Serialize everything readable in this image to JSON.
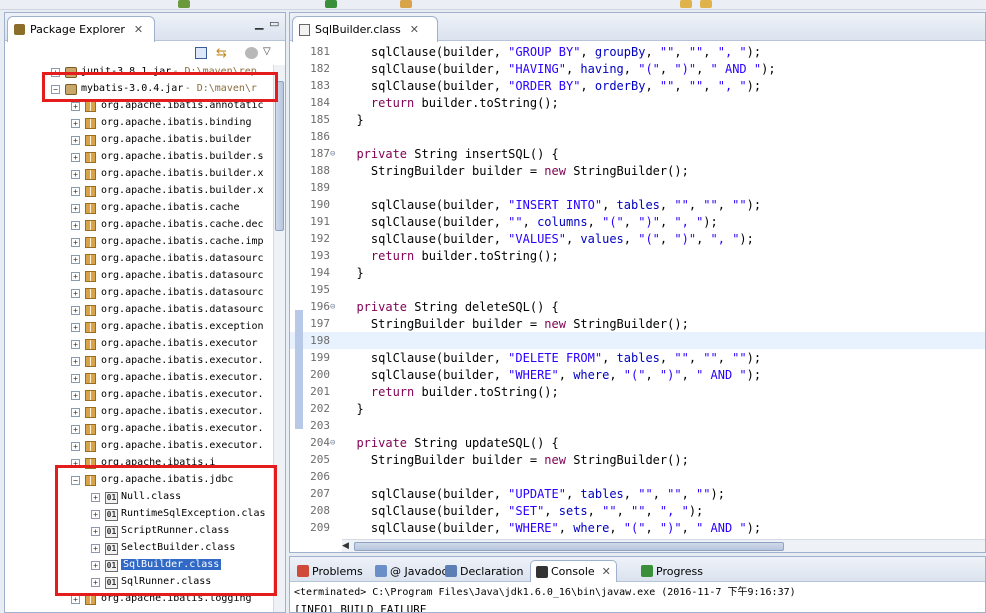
{
  "left_panel": {
    "tab_title": "Package Explorer",
    "tree": [
      {
        "indent": 1,
        "type": "jar",
        "label": "junit-3.8.1.jar",
        "path": " - D:\\maven\\rep"
      },
      {
        "indent": 1,
        "type": "jar",
        "label": "mybatis-3.0.4.jar",
        "path": " - D:\\maven\\r",
        "expanded": true
      },
      {
        "indent": 2,
        "type": "pkg",
        "label": "org.apache.ibatis.annotatic"
      },
      {
        "indent": 2,
        "type": "pkg",
        "label": "org.apache.ibatis.binding"
      },
      {
        "indent": 2,
        "type": "pkg",
        "label": "org.apache.ibatis.builder"
      },
      {
        "indent": 2,
        "type": "pkg",
        "label": "org.apache.ibatis.builder.s"
      },
      {
        "indent": 2,
        "type": "pkg",
        "label": "org.apache.ibatis.builder.x"
      },
      {
        "indent": 2,
        "type": "pkg",
        "label": "org.apache.ibatis.builder.x"
      },
      {
        "indent": 2,
        "type": "pkg",
        "label": "org.apache.ibatis.cache"
      },
      {
        "indent": 2,
        "type": "pkg",
        "label": "org.apache.ibatis.cache.dec"
      },
      {
        "indent": 2,
        "type": "pkg",
        "label": "org.apache.ibatis.cache.imp"
      },
      {
        "indent": 2,
        "type": "pkg",
        "label": "org.apache.ibatis.datasourc"
      },
      {
        "indent": 2,
        "type": "pkg",
        "label": "org.apache.ibatis.datasourc"
      },
      {
        "indent": 2,
        "type": "pkg",
        "label": "org.apache.ibatis.datasourc"
      },
      {
        "indent": 2,
        "type": "pkg",
        "label": "org.apache.ibatis.datasourc"
      },
      {
        "indent": 2,
        "type": "pkg",
        "label": "org.apache.ibatis.exception"
      },
      {
        "indent": 2,
        "type": "pkg",
        "label": "org.apache.ibatis.executor"
      },
      {
        "indent": 2,
        "type": "pkg",
        "label": "org.apache.ibatis.executor."
      },
      {
        "indent": 2,
        "type": "pkg",
        "label": "org.apache.ibatis.executor."
      },
      {
        "indent": 2,
        "type": "pkg",
        "label": "org.apache.ibatis.executor."
      },
      {
        "indent": 2,
        "type": "pkg",
        "label": "org.apache.ibatis.executor."
      },
      {
        "indent": 2,
        "type": "pkg",
        "label": "org.apache.ibatis.executor."
      },
      {
        "indent": 2,
        "type": "pkg",
        "label": "org.apache.ibatis.executor."
      },
      {
        "indent": 2,
        "type": "pkg",
        "label": "org.apache.ibatis.i"
      },
      {
        "indent": 2,
        "type": "pkg",
        "label": "org.apache.ibatis.jdbc",
        "expanded": true
      },
      {
        "indent": 3,
        "type": "cls",
        "label": "Null.class"
      },
      {
        "indent": 3,
        "type": "cls",
        "label": "RuntimeSqlException.clas"
      },
      {
        "indent": 3,
        "type": "cls",
        "label": "ScriptRunner.class"
      },
      {
        "indent": 3,
        "type": "cls",
        "label": "SelectBuilder.class"
      },
      {
        "indent": 3,
        "type": "cls",
        "label": "SqlBuilder.class",
        "selected": true
      },
      {
        "indent": 3,
        "type": "cls",
        "label": "SqlRunner.class"
      },
      {
        "indent": 2,
        "type": "pkg",
        "label": "org.apache.ibatis.logging"
      }
    ]
  },
  "editor": {
    "tab_title": "SqlBuilder.class",
    "lines": [
      {
        "n": "181",
        "tokens": [
          [
            "",
            "    sqlClause(builder, "
          ],
          [
            "str",
            "\"GROUP BY\""
          ],
          [
            "",
            ", "
          ],
          [
            "fld",
            "groupBy"
          ],
          [
            "",
            ", "
          ],
          [
            "str",
            "\"\""
          ],
          [
            "",
            ", "
          ],
          [
            "str",
            "\"\""
          ],
          [
            "",
            ", "
          ],
          [
            "str",
            "\", \""
          ],
          [
            "",
            ");"
          ]
        ]
      },
      {
        "n": "182",
        "tokens": [
          [
            "",
            "    sqlClause(builder, "
          ],
          [
            "str",
            "\"HAVING\""
          ],
          [
            "",
            ", "
          ],
          [
            "fld",
            "having"
          ],
          [
            "",
            ", "
          ],
          [
            "str",
            "\"(\""
          ],
          [
            "",
            ", "
          ],
          [
            "str",
            "\")\""
          ],
          [
            "",
            ", "
          ],
          [
            "str",
            "\" AND \""
          ],
          [
            "",
            ");"
          ]
        ]
      },
      {
        "n": "183",
        "tokens": [
          [
            "",
            "    sqlClause(builder, "
          ],
          [
            "str",
            "\"ORDER BY\""
          ],
          [
            "",
            ", "
          ],
          [
            "fld",
            "orderBy"
          ],
          [
            "",
            ", "
          ],
          [
            "str",
            "\"\""
          ],
          [
            "",
            ", "
          ],
          [
            "str",
            "\"\""
          ],
          [
            "",
            ", "
          ],
          [
            "str",
            "\", \""
          ],
          [
            "",
            ");"
          ]
        ]
      },
      {
        "n": "184",
        "tokens": [
          [
            "",
            "    "
          ],
          [
            "kw",
            "return"
          ],
          [
            "",
            " builder.toString();"
          ]
        ]
      },
      {
        "n": "185",
        "tokens": [
          [
            "",
            "  }"
          ]
        ]
      },
      {
        "n": "186",
        "tokens": [
          [
            "",
            ""
          ]
        ]
      },
      {
        "n": "187",
        "fold": true,
        "tokens": [
          [
            "",
            "  "
          ],
          [
            "kw",
            "private"
          ],
          [
            "",
            " String insertSQL() {"
          ]
        ]
      },
      {
        "n": "188",
        "tokens": [
          [
            "",
            "    StringBuilder builder = "
          ],
          [
            "kw",
            "new"
          ],
          [
            "",
            " StringBuilder();"
          ]
        ]
      },
      {
        "n": "189",
        "tokens": [
          [
            "",
            ""
          ]
        ]
      },
      {
        "n": "190",
        "tokens": [
          [
            "",
            "    sqlClause(builder, "
          ],
          [
            "str",
            "\"INSERT INTO\""
          ],
          [
            "",
            ", "
          ],
          [
            "fld",
            "tables"
          ],
          [
            "",
            ", "
          ],
          [
            "str",
            "\"\""
          ],
          [
            "",
            ", "
          ],
          [
            "str",
            "\"\""
          ],
          [
            "",
            ", "
          ],
          [
            "str",
            "\"\""
          ],
          [
            "",
            ");"
          ]
        ]
      },
      {
        "n": "191",
        "tokens": [
          [
            "",
            "    sqlClause(builder, "
          ],
          [
            "str",
            "\"\""
          ],
          [
            "",
            ", "
          ],
          [
            "fld",
            "columns"
          ],
          [
            "",
            ", "
          ],
          [
            "str",
            "\"(\""
          ],
          [
            "",
            ", "
          ],
          [
            "str",
            "\")\""
          ],
          [
            "",
            ", "
          ],
          [
            "str",
            "\", \""
          ],
          [
            "",
            ");"
          ]
        ]
      },
      {
        "n": "192",
        "tokens": [
          [
            "",
            "    sqlClause(builder, "
          ],
          [
            "str",
            "\"VALUES\""
          ],
          [
            "",
            ", "
          ],
          [
            "fld",
            "values"
          ],
          [
            "",
            ", "
          ],
          [
            "str",
            "\"(\""
          ],
          [
            "",
            ", "
          ],
          [
            "str",
            "\")\""
          ],
          [
            "",
            ", "
          ],
          [
            "str",
            "\", \""
          ],
          [
            "",
            ");"
          ]
        ]
      },
      {
        "n": "193",
        "tokens": [
          [
            "",
            "    "
          ],
          [
            "kw",
            "return"
          ],
          [
            "",
            " builder.toString();"
          ]
        ]
      },
      {
        "n": "194",
        "tokens": [
          [
            "",
            "  }"
          ]
        ]
      },
      {
        "n": "195",
        "tokens": [
          [
            "",
            ""
          ]
        ]
      },
      {
        "n": "196",
        "fold": true,
        "tokens": [
          [
            "",
            "  "
          ],
          [
            "kw",
            "private"
          ],
          [
            "",
            " String deleteSQL() {"
          ]
        ]
      },
      {
        "n": "197",
        "tokens": [
          [
            "",
            "    StringBuilder builder = "
          ],
          [
            "kw",
            "new"
          ],
          [
            "",
            " StringBuilder();"
          ]
        ]
      },
      {
        "n": "198",
        "current": true,
        "tokens": [
          [
            "",
            ""
          ]
        ]
      },
      {
        "n": "199",
        "tokens": [
          [
            "",
            "    sqlClause(builder, "
          ],
          [
            "str",
            "\"DELETE FROM\""
          ],
          [
            "",
            ", "
          ],
          [
            "fld",
            "tables"
          ],
          [
            "",
            ", "
          ],
          [
            "str",
            "\"\""
          ],
          [
            "",
            ", "
          ],
          [
            "str",
            "\"\""
          ],
          [
            "",
            ", "
          ],
          [
            "str",
            "\"\""
          ],
          [
            "",
            ");"
          ]
        ]
      },
      {
        "n": "200",
        "tokens": [
          [
            "",
            "    sqlClause(builder, "
          ],
          [
            "str",
            "\"WHERE\""
          ],
          [
            "",
            ", "
          ],
          [
            "fld",
            "where"
          ],
          [
            "",
            ", "
          ],
          [
            "str",
            "\"(\""
          ],
          [
            "",
            ", "
          ],
          [
            "str",
            "\")\""
          ],
          [
            "",
            ", "
          ],
          [
            "str",
            "\" AND \""
          ],
          [
            "",
            ");"
          ]
        ]
      },
      {
        "n": "201",
        "tokens": [
          [
            "",
            "    "
          ],
          [
            "kw",
            "return"
          ],
          [
            "",
            " builder.toString();"
          ]
        ]
      },
      {
        "n": "202",
        "tokens": [
          [
            "",
            "  }"
          ]
        ]
      },
      {
        "n": "203",
        "tokens": [
          [
            "",
            ""
          ]
        ]
      },
      {
        "n": "204",
        "fold": true,
        "tokens": [
          [
            "",
            "  "
          ],
          [
            "kw",
            "private"
          ],
          [
            "",
            " String updateSQL() {"
          ]
        ]
      },
      {
        "n": "205",
        "tokens": [
          [
            "",
            "    StringBuilder builder = "
          ],
          [
            "kw",
            "new"
          ],
          [
            "",
            " StringBuilder();"
          ]
        ]
      },
      {
        "n": "206",
        "tokens": [
          [
            "",
            ""
          ]
        ]
      },
      {
        "n": "207",
        "tokens": [
          [
            "",
            "    sqlClause(builder, "
          ],
          [
            "str",
            "\"UPDATE\""
          ],
          [
            "",
            ", "
          ],
          [
            "fld",
            "tables"
          ],
          [
            "",
            ", "
          ],
          [
            "str",
            "\"\""
          ],
          [
            "",
            ", "
          ],
          [
            "str",
            "\"\""
          ],
          [
            "",
            ", "
          ],
          [
            "str",
            "\"\""
          ],
          [
            "",
            ");"
          ]
        ]
      },
      {
        "n": "208",
        "tokens": [
          [
            "",
            "    sqlClause(builder, "
          ],
          [
            "str",
            "\"SET\""
          ],
          [
            "",
            ", "
          ],
          [
            "fld",
            "sets"
          ],
          [
            "",
            ", "
          ],
          [
            "str",
            "\"\""
          ],
          [
            "",
            ", "
          ],
          [
            "str",
            "\"\""
          ],
          [
            "",
            ", "
          ],
          [
            "str",
            "\", \""
          ],
          [
            "",
            ");"
          ]
        ]
      },
      {
        "n": "209",
        "tokens": [
          [
            "",
            "    sqlClause(builder, "
          ],
          [
            "str",
            "\"WHERE\""
          ],
          [
            "",
            ", "
          ],
          [
            "fld",
            "where"
          ],
          [
            "",
            ", "
          ],
          [
            "str",
            "\"(\""
          ],
          [
            "",
            ", "
          ],
          [
            "str",
            "\")\""
          ],
          [
            "",
            ", "
          ],
          [
            "str",
            "\" AND \""
          ],
          [
            "",
            ");"
          ]
        ]
      }
    ]
  },
  "bottom_panel": {
    "tabs": [
      {
        "label": "Problems",
        "icon": "problems-icon"
      },
      {
        "label": "@ Javadoc",
        "icon": "javadoc-icon"
      },
      {
        "label": "Declaration",
        "icon": "declaration-icon"
      },
      {
        "label": "Console",
        "icon": "console-icon",
        "active": true
      },
      {
        "label": "Progress",
        "icon": "progress-icon"
      }
    ],
    "terminated": "<terminated> C:\\Program Files\\Java\\jdk1.6.0_16\\bin\\javaw.exe (2016-11-7 下午9:16:37)",
    "output": "[INFO] BUILD FAILURE"
  },
  "colors": {
    "keyword": "#7f0055",
    "string": "#2a00ff",
    "field": "#0000c0",
    "selection": "#3169c6",
    "highlight": "#e51c1c"
  }
}
